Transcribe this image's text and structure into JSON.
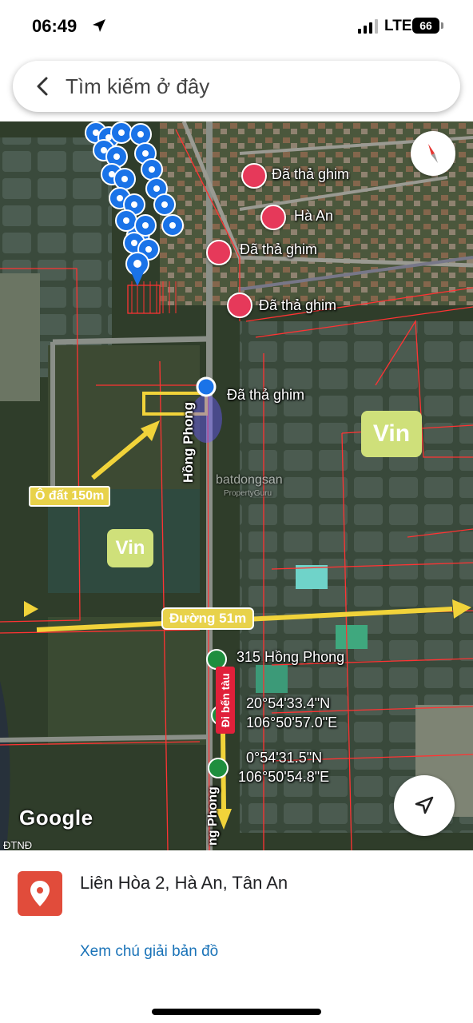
{
  "status_bar": {
    "time": "06:49",
    "network": "LTE",
    "battery": "66"
  },
  "search": {
    "placeholder": "Tìm kiếm ở đây"
  },
  "map": {
    "pins": [
      {
        "label": "Đã thả ghim"
      },
      {
        "label": "Hà An"
      },
      {
        "label": "Đã thả ghim"
      },
      {
        "label": "Đã thả ghim"
      },
      {
        "label": "Đã thả ghim"
      }
    ],
    "poi_315": "315 Hồng Phong",
    "street": "Hồng Phong",
    "street_bottom": "ng Phong",
    "coord1_lat": "20°54'33.4\"N",
    "coord1_lng": "106°50'57.0\"E",
    "coord2_lat": "0°54'31.5\"N",
    "coord2_lng": "106°50'54.8\"E",
    "annotations": {
      "vin_right": "Vin",
      "vin_left": "Vin",
      "lot": "Ô đất 150m",
      "road": "Đường 51m",
      "ferry": "Đi bến tàu"
    },
    "watermark": "batdongsan",
    "watermark_sub": "PropertyGuru",
    "google": "Google",
    "corner_label": "ĐTNĐ"
  },
  "place": {
    "title": "Liên Hòa 2, Hà An, Tân An",
    "legend_link": "Xem chú giải bản đồ"
  },
  "colors": {
    "boundary": "#ff3333",
    "pin_blue": "#1a73e8",
    "heart": "#e6395a",
    "annotation_yellow": "#f1d33a",
    "vin_box": "#cfe07a"
  }
}
